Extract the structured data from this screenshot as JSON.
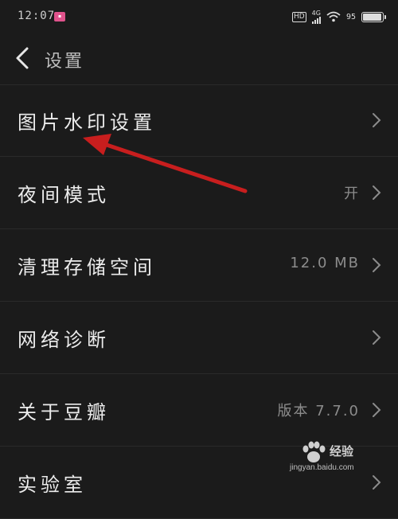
{
  "status_bar": {
    "time": "12:07",
    "network": "4G",
    "hd": "HD",
    "battery_text": "95",
    "battery_level": 0.95
  },
  "nav": {
    "title": "设置"
  },
  "settings": [
    {
      "label": "图片水印设置",
      "value": ""
    },
    {
      "label": "夜间模式",
      "value": "开"
    },
    {
      "label": "清理存储空间",
      "value": "12.0 MB"
    },
    {
      "label": "网络诊断",
      "value": ""
    },
    {
      "label": "关于豆瓣",
      "value": "版本 7.7.0"
    },
    {
      "label": "实验室",
      "value": ""
    }
  ],
  "watermark": {
    "name": "经验",
    "url": "jingyan.baidu.com"
  },
  "colors": {
    "background": "#1b1b1b",
    "annotation_arrow": "#c81e1e"
  }
}
